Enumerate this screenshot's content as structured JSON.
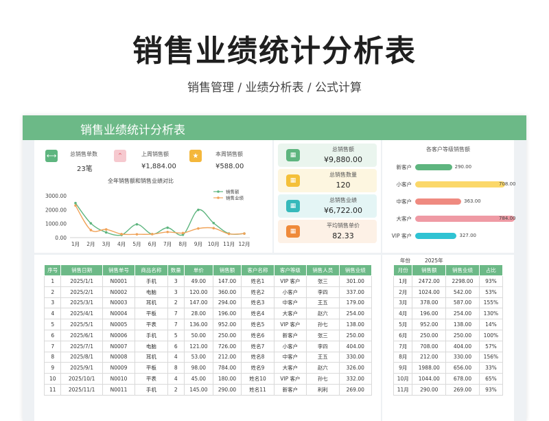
{
  "promo": {
    "title": "销售业绩统计分析表",
    "subtitle": "销售管理 / 业绩分析表  / 公式计算"
  },
  "sheet": {
    "title": "销售业绩统计分析表"
  },
  "kpis": [
    {
      "label": "总销售单数",
      "value": "23笔",
      "color": "#5eb57f",
      "icon": "share-icon"
    },
    {
      "label": "上周销售额",
      "value": "¥1,884.00",
      "color": "#ef8d98",
      "icon": "chevrons-up-icon"
    },
    {
      "label": "本周销售额",
      "value": "¥588.00",
      "color": "#f4b73b",
      "icon": "star-icon"
    }
  ],
  "summary_cards": [
    {
      "label": "总销售额",
      "value": "¥9,880.00",
      "bg": "#eaf5ee",
      "color": "#5eb57f",
      "icon": "bar-chart-icon"
    },
    {
      "label": "总销售数量",
      "value": "120",
      "bg": "#fdf6e0",
      "color": "#f4c039",
      "icon": "bar-chart-icon"
    },
    {
      "label": "总销售业绩",
      "value": "¥6,722.00",
      "bg": "#e4f5f5",
      "color": "#36b9bb",
      "icon": "bar-chart-icon"
    },
    {
      "label": "平均销售单价",
      "value": "82.33",
      "bg": "#fdf1e6",
      "color": "#ef8a3a",
      "icon": "bar-chart-icon"
    }
  ],
  "chart_data": [
    {
      "type": "line",
      "title": "全年销售额和销售业绩对比",
      "categories": [
        "1月",
        "2月",
        "3月",
        "4月",
        "5月",
        "6月",
        "7月",
        "8月",
        "9月",
        "10月",
        "11月",
        "12月"
      ],
      "ylim": [
        0,
        3000
      ],
      "yticks": [
        "3000.00",
        "2000.00",
        "1000.00",
        "0.00"
      ],
      "legend_position": "top-right",
      "series": [
        {
          "name": "销售额",
          "color": "#5eb57f",
          "values": [
            2472,
            1024,
            378,
            196,
            952,
            250,
            708,
            212,
            1988,
            1044,
            290,
            290
          ]
        },
        {
          "name": "销售业绩",
          "color": "#f0a35a",
          "values": [
            2298,
            542,
            587,
            254,
            238,
            250,
            404,
            330,
            656,
            678,
            269,
            290
          ]
        }
      ]
    },
    {
      "type": "bar",
      "title": "各客户等级销售额",
      "orientation": "horizontal",
      "categories": [
        "新客户",
        "小客户",
        "中客户",
        "大客户",
        "VIP 客户"
      ],
      "values": [
        290,
        708,
        363,
        784,
        327
      ],
      "value_labels": [
        "290.00",
        "708.00",
        "363.00",
        "784.00",
        "327.00"
      ],
      "colors": [
        "#5eb57f",
        "#fbd86a",
        "#ef8a80",
        "#ef9aa4",
        "#2fc3d3"
      ],
      "xlim": [
        0,
        800
      ]
    }
  ],
  "orders_table": {
    "headers": [
      "序号",
      "销售日期",
      "销售单号",
      "商品名称",
      "数量",
      "单价",
      "销售额",
      "客户名称",
      "客户等级",
      "销售人员",
      "销售业绩"
    ],
    "rows": [
      [
        "1",
        "2025/1/1",
        "N0001",
        "手机",
        "3",
        "49.00",
        "147.00",
        "姓名1",
        "VIP 客户",
        "张三",
        "301.00"
      ],
      [
        "2",
        "2025/2/1",
        "N0002",
        "电脑",
        "3",
        "120.00",
        "360.00",
        "姓名2",
        "小客户",
        "李四",
        "337.00"
      ],
      [
        "3",
        "2025/3/1",
        "N0003",
        "耳机",
        "2",
        "147.00",
        "294.00",
        "姓名3",
        "中客户",
        "王五",
        "179.00"
      ],
      [
        "4",
        "2025/4/1",
        "N0004",
        "平板",
        "7",
        "28.00",
        "196.00",
        "姓名4",
        "大客户",
        "赵六",
        "254.00"
      ],
      [
        "5",
        "2025/5/1",
        "N0005",
        "平表",
        "7",
        "136.00",
        "952.00",
        "姓名5",
        "VIP 客户",
        "孙七",
        "138.00"
      ],
      [
        "6",
        "2025/6/1",
        "N0006",
        "手机",
        "5",
        "50.00",
        "250.00",
        "姓名6",
        "新客户",
        "张三",
        "250.00"
      ],
      [
        "7",
        "2025/7/1",
        "N0007",
        "电脑",
        "6",
        "121.00",
        "726.00",
        "姓名7",
        "小客户",
        "李四",
        "404.00"
      ],
      [
        "8",
        "2025/8/1",
        "N0008",
        "耳机",
        "4",
        "53.00",
        "212.00",
        "姓名8",
        "中客户",
        "王五",
        "330.00"
      ],
      [
        "9",
        "2025/9/1",
        "N0009",
        "平板",
        "8",
        "98.00",
        "784.00",
        "姓名9",
        "大客户",
        "赵六",
        "326.00"
      ],
      [
        "10",
        "2025/10/1",
        "N0010",
        "平表",
        "4",
        "45.00",
        "180.00",
        "姓名10",
        "VIP 客户",
        "孙七",
        "332.00"
      ],
      [
        "11",
        "2025/11/1",
        "N0011",
        "手机",
        "2",
        "145.00",
        "290.00",
        "姓名11",
        "新客户",
        "利利",
        "269.00"
      ]
    ]
  },
  "monthly_table": {
    "year_label": "年份",
    "year_value": "2025年",
    "headers": [
      "月份",
      "销售额",
      "销售业绩",
      "占比"
    ],
    "rows": [
      [
        "1月",
        "2472.00",
        "2298.00",
        "93%"
      ],
      [
        "2月",
        "1024.00",
        "542.00",
        "53%"
      ],
      [
        "3月",
        "378.00",
        "587.00",
        "155%"
      ],
      [
        "4月",
        "196.00",
        "254.00",
        "130%"
      ],
      [
        "5月",
        "952.00",
        "138.00",
        "14%"
      ],
      [
        "6月",
        "250.00",
        "250.00",
        "100%"
      ],
      [
        "7月",
        "708.00",
        "404.00",
        "57%"
      ],
      [
        "8月",
        "212.00",
        "330.00",
        "156%"
      ],
      [
        "9月",
        "1988.00",
        "656.00",
        "33%"
      ],
      [
        "10月",
        "1044.00",
        "678.00",
        "65%"
      ],
      [
        "11月",
        "290.00",
        "269.00",
        "93%"
      ]
    ]
  }
}
